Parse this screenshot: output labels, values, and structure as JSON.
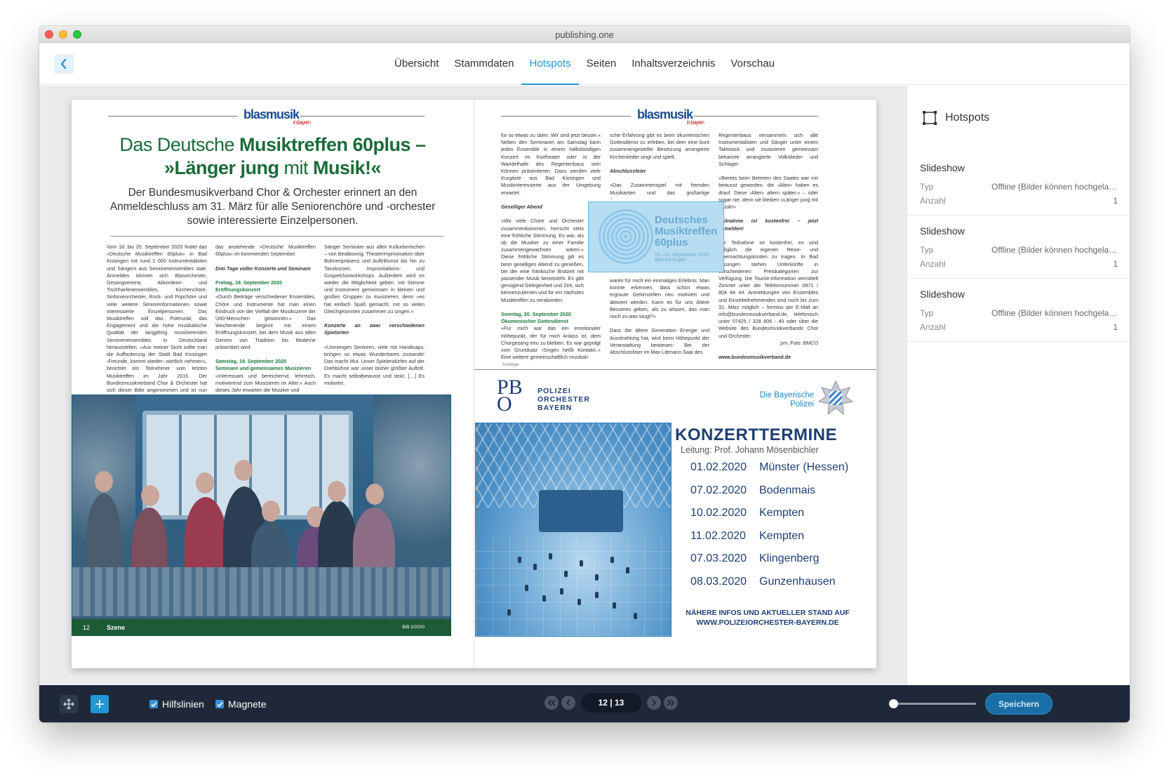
{
  "window": {
    "title": "publishing.one"
  },
  "nav": {
    "tabs": [
      {
        "label": "Übersicht"
      },
      {
        "label": "Stammdaten"
      },
      {
        "label": "Hotspots",
        "active": true
      },
      {
        "label": "Seiten"
      },
      {
        "label": "Inhaltsverzeichnis"
      },
      {
        "label": "Vorschau"
      }
    ]
  },
  "spread": {
    "left": {
      "logo": "blasmusik",
      "logo_sub": "in bayern",
      "headline_1a": "Das Deutsche ",
      "headline_1b": "Musiktreffen 60plus –",
      "headline_2a": "»Länger jung",
      "headline_2b": " mit ",
      "headline_2c": "Musik!«",
      "subhead": "Der Bundesmusikverband Chor & Orchester erinnert an den Anmeldeschluss am 31. März für alle Seniorenchöre und -orchester sowie interessierte Einzelpersonen.",
      "col1": "Vom 18. bis 20. September 2020 findet das »Deutsche Musiktreffen 60plus« in Bad Kissingen mit rund 1 000 Instrumentalisten und Sängern aus Seniorenensembles statt. Anmelden können sich Blasorchester, Gesangvereine, Akkordeon- und Tischharfenensembles, Kirchenchöre, Sinfonieorchester, Rock- und Popchöre und viele weitere Seniorenformationen sowie interessierte Einzelpersonen. Das Musiktreffen soll das Potenzial, das Engagement und die hohe musikalische Qualität der langjährig musizierenden Seniorenensembles in Deutschland herausstellen. »Aus meiner Sicht sollte man die Aufforderung der Stadt Bad Kissingen ›Freunde, kommt wieder‹ wörtlich nehmen«, berichtet ein Teilnehmer vom letzten Musiktreffen im Jahr 2016. Der Bundesmusikverband Chor & Orchester hat sich dieser Bitte angenommen und ist nun mitten in der Planung für",
      "col2_intro": "das anstehende »Deutsche Musiktreffen 60plus« im kommenden September.",
      "col2_h1": "Drei Tage voller Konzerte und Seminare",
      "col2_g1": "Freitag, 18. September 2020",
      "col2_g1b": "Eröffnungskonzert",
      "col2_p1": "»Durch Beiträge verschiedener Ensembles, Chöre und Instrumente hat man einen Eindruck von der Vielfalt der Musikszene der Ü60-Menschen gewonnen.« Das Wochenende beginnt mit einem Eröffnungskonzert, bei dem Musik aus allen Genres von Tradition bis Moderne präsentiert wird.",
      "col2_g2": "Samstag, 19. September 2020",
      "col2_g2b": "Seminare und gemeinsames Musizieren",
      "col2_p2": "»Interessant und bereichernd, lehrreich, motivierend zum Musizieren im Alter.« Auch dieses Jahr erwarten die Musiker und",
      "col3_p1": "Sänger Seminare aus allen Kulturbereichen – von Beatboxing, Theaterimprovisation über Bühnenpräsenz und Auftrittsmut bis hin zu Tanzkursen, Improvisations- und Gospelchorworkshops. Außerdem wird es wieder die Möglichkeit geben, mit Stimme und Instrument gemeinsam in kleinen und großen Gruppen zu musizieren, denn »es hat einfach Spaß gemacht, mit so vielen Gleichgesinnten zusammen zu singen.«",
      "col3_h": "Konzerte an zwei verschiedenen Spielorten",
      "col3_p2": "»Unmengen Senioren, viele mit Handicaps, bringen so etwas Wunderbares zustande! Das macht Mut. Unser Spielendürfen auf der Drehbühne war unser bisher größter Auftritt. Es macht selbstbewusst und stolz. […] Es motiviert,",
      "footer_page": "12",
      "footer_section": "Szene",
      "footer_issue": "BiB 2/2020"
    },
    "right": {
      "logo": "blasmusik",
      "logo_sub": "in bayern",
      "col1": "für so etwas zu üben. Wir sind jetzt besser.« Neben den Seminaren am Samstag kann jedes Ensemble in einem halbstündigen Konzert im Kurtheater oder in der Wandelhalle des Regentenbaus sein Können präsentieren. Dazu werden viele Kurgäste aus Bad Kissingen und Musikinteressierte aus der Umgebung erwartet.",
      "col1_h": "Geselliger Abend",
      "col1_p2": "»Wo viele Chöre und Orchester zusammenkommen, herrscht stets eine fröhliche Stimmung. Es war, als ob die Musiker zu einer Familie zusammengewachsen wären.« Diese fröhliche Stimmung gilt es beim geselligen Abend zu genießen, bei der eine fränkische Brotzeit mit passender Musik bereitsteht. Es gibt genügend Gelegenheit und Zeit, sich kennenzulernen und für ein nächstes Musiktreffen zu verabreden.",
      "col1_g": "Sonntag, 20. September 2020",
      "col1_gb": "Ökumenischer Gottesdienst",
      "col1_p3": "»Für mich war das ein emotionaler Höhepunkt, der für mich Anlass ist, dem Chorgesang treu zu bleiben. Es war geprägt vom Grundsatz ›Singen heißt Kontakt‹.« Eine weitere gemeinschaftlich musikali-",
      "col2": "sche Erfahrung gibt es beim ökumenischen Gottesdienst zu erleben, bei dem eine bunt zusammengestellte Besetzung arrangierte Kirchenlieder singt und spielt.",
      "col2_h": "Abschlussfeier",
      "col2_p2": "»Das Zusammenspiel mit fremden Musikanten und das großartige Arrangement",
      "col2_p3": "waren für mich ein einmaliges Erlebnis. Man konnte erkennen, dass schon etwas ergraute Gehirnzellen neu motiviert und aktiviert werden. Kann es für uns Ältere Besseres geben, als zu wissen, das man noch zu was taugt?«",
      "col2_p4": "Dass die ältere Generation Energie und Ausstrahlung hat, wird beim Höhepunkt der Veranstaltung bewiesen: Bei der Abschlussfeier im Max-Littmann-Saal des",
      "col3": "Regentenbaus versammeln sich alle Instrumentalisten und Sänger unter einem Taktstock und musizieren gemeinsam bekannte arrangierte Volkslieder und Schlager.",
      "col3_p2": "»Bereits beim Betreten des Saales war mir bewusst geworden, die ›Alten‹ haben es drauf. Diese ›Alten‹ altern später.« – oder sogar nie, denn sie bleiben »Länger jung mit Musik!«",
      "col3_h": "Teilnahme ist kostenfrei – jetzt anmelden!",
      "col3_p3": "Die Teilnahme ist kostenfrei, es sind lediglich die eigenen Reise- und Übernachtungskosten zu tragen. In Bad Kissingen stehen Unterkünfte in verschiedenen Preiskategorien zur Verfügung. Die Tourist-Information vermittelt Zimmer unter der Telefonnummer 0971 / 804 84 44. Anmeldungen von Ensembles und Einzelteilnehmenden sind noch bis zum 31. März möglich – formlos per E-Mail an info@bundesmusikverband.de, telefonisch unter 07425 / 328 806 - 40 oder über die Website des Bundesmusikverbands Chor und Orchester.",
      "col3_credit": "pm, Foto: BMCO",
      "col3_url": "www.bundesmusikverband.de",
      "hotspot_logo_1": "Deutsches",
      "hotspot_logo_2": "Musiktreffen",
      "hotspot_logo_3": "60plus",
      "hotspot_logo_date": "18.–20. September 2020",
      "hotspot_logo_place": "Bad Kissingen",
      "ad_label": "Anzeige",
      "pob_letters": "PB O",
      "pob_line1": "POLIZEI",
      "pob_line2": "ORCHESTER",
      "pob_line3": "BAYERN",
      "bay_line1": "Die Bayerische",
      "bay_line2": "Polizei",
      "kt_title": "KONZERTTERMINE",
      "kt_sub": "Leitung: Prof. Johann Mösenbichler",
      "concerts": [
        {
          "date": "01.02.2020",
          "city": "Münster (Hessen)"
        },
        {
          "date": "07.02.2020",
          "city": "Bodenmais"
        },
        {
          "date": "10.02.2020",
          "city": "Kempten"
        },
        {
          "date": "11.02.2020",
          "city": "Kempten"
        },
        {
          "date": "07.03.2020",
          "city": "Klingenberg"
        },
        {
          "date": "08.03.2020",
          "city": "Gunzenhausen"
        }
      ],
      "kt_foot1": "NÄHERE INFOS UND AKTUELLER STAND AUF",
      "kt_foot2": "WWW.POLIZEIORCHESTER-BAYERN.DE"
    }
  },
  "sidebar": {
    "title": "Hotspots",
    "items": [
      {
        "name": "Slideshow",
        "type_label": "Typ",
        "type_value": "Offline (Bilder können hochgeladen werden)",
        "count_label": "Anzahl",
        "count_value": "1"
      },
      {
        "name": "Slideshow",
        "type_label": "Typ",
        "type_value": "Offline (Bilder können hochgeladen werden)",
        "count_label": "Anzahl",
        "count_value": "1"
      },
      {
        "name": "Slideshow",
        "type_label": "Typ",
        "type_value": "Offline (Bilder können hochgeladen werden)",
        "count_label": "Anzahl",
        "count_value": "1"
      }
    ]
  },
  "bottombar": {
    "guides_label": "Hilfslinien",
    "guides_checked": true,
    "magnets_label": "Magnete",
    "magnets_checked": true,
    "page_indicator": "12 | 13",
    "zoom_level": 0,
    "save_label": "Speichern"
  },
  "colors": {
    "accent": "#1f97d4",
    "headline_green": "#1b6b3a",
    "bottombar_bg": "#1e2838",
    "hotspot_overlay": "#1f86c6"
  },
  "icons": {
    "back": "chevron-left-icon",
    "hotspots": "hotspot-frame-icon",
    "move": "move-arrows-icon",
    "add": "plus-icon",
    "first": "double-chevron-left-icon",
    "prev": "chevron-left-icon",
    "next": "chevron-right-icon",
    "last": "double-chevron-right-icon"
  }
}
